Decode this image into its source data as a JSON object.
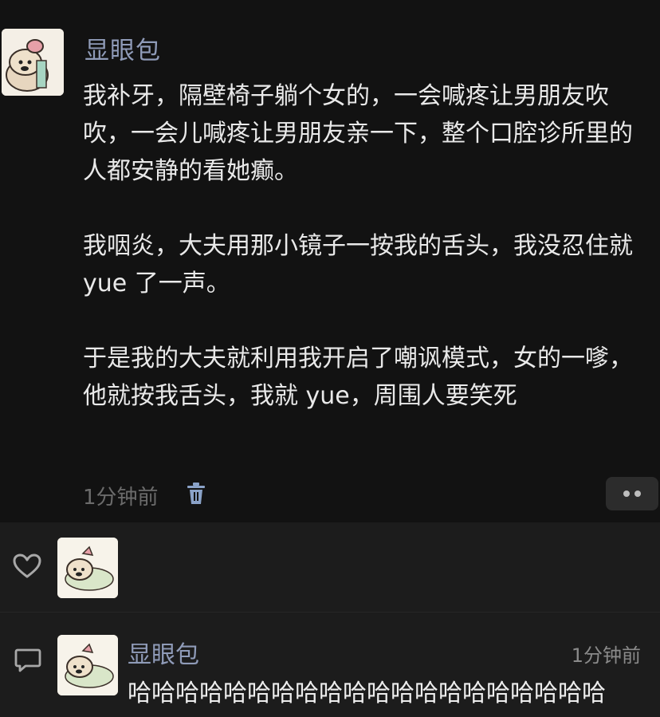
{
  "post": {
    "username": "显眼包",
    "paragraphs": [
      "我补牙，隔壁椅子躺个女的，一会喊疼让男朋友吹吹，一会儿喊疼让男朋友亲一下，整个口腔诊所里的人都安静的看她癫。",
      "我咽炎，大夫用那小镜子一按我的舌头，我没忍住就 yue 了一声。",
      "于是我的大夫就利用我开启了嘲讽模式，女的一嗲，他就按我舌头，我就 yue，周围人要笑死"
    ],
    "time": "1分钟前",
    "icons": {
      "delete": "trash-icon",
      "more": "more-dots-icon"
    }
  },
  "likes": {
    "icon": "heart-icon"
  },
  "comment": {
    "icon": "comment-icon",
    "username": "显眼包",
    "time": "1分钟前",
    "text": "哈哈哈哈哈哈哈哈哈哈哈哈哈哈哈哈哈哈哈哈"
  },
  "colors": {
    "background": "#121212",
    "panel": "#1c1c1c",
    "username": "#8f9bb8",
    "text": "#e9e9e9",
    "muted": "#6b6b6b"
  }
}
